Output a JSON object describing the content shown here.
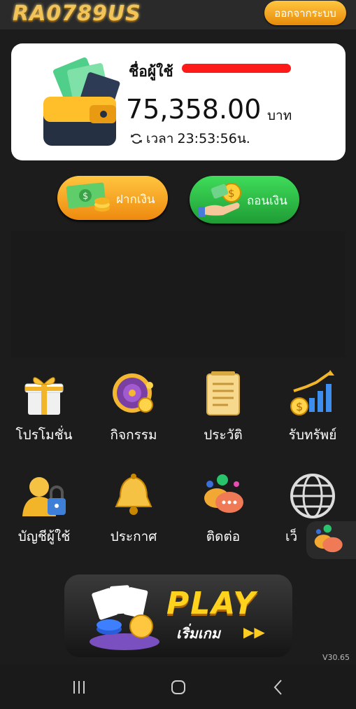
{
  "header": {
    "logo_text": "RA0789US",
    "logout_label": "ออกจากระบบ"
  },
  "account": {
    "username_label": "ชื่อผู้ใช้",
    "balance": "75,358.00",
    "currency": "บาท",
    "time_label": "เวลา",
    "time_value": "23:53:56น."
  },
  "actions": {
    "deposit_label": "ฝากเงิน",
    "withdraw_label": "ถอนเงิน"
  },
  "menu": {
    "items": [
      {
        "label": "โปรโมชั่น",
        "icon": "gift-icon"
      },
      {
        "label": "กิจกรรม",
        "icon": "wheel-icon"
      },
      {
        "label": "ประวัติ",
        "icon": "notepad-icon"
      },
      {
        "label": "รับทรัพย์",
        "icon": "growth-chart-icon"
      },
      {
        "label": "บัญชีผู้ใช้",
        "icon": "user-lock-icon"
      },
      {
        "label": "ประกาศ",
        "icon": "bell-icon"
      },
      {
        "label": "ติดต่อ",
        "icon": "chat-bubbles-icon"
      },
      {
        "label": "เว็",
        "icon": "globe-icon"
      }
    ]
  },
  "play_banner": {
    "title": "PLAY",
    "subtitle": "เริ่มเกม",
    "arrows": "▶▶"
  },
  "version": "V30.65",
  "colors": {
    "background": "#1c1c1c",
    "gold": "#ffc640",
    "green": "#3fdc5a"
  }
}
